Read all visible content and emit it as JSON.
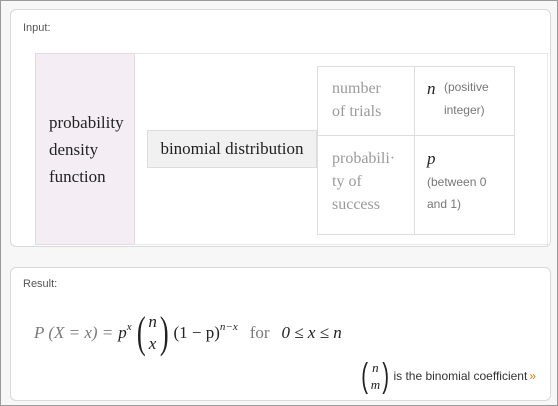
{
  "input": {
    "title": "Input:",
    "function_label_lines": [
      "probability",
      "density",
      "function"
    ],
    "distribution": "binomial distribution",
    "params": [
      {
        "name_lines": [
          "number",
          "of trials"
        ],
        "symbol": "n",
        "note": "(positive integer)"
      },
      {
        "name_lines": [
          "probabili·",
          "ty of",
          "success"
        ],
        "symbol": "p",
        "note": "(between 0 and 1)"
      }
    ]
  },
  "result": {
    "title": "Result:",
    "formula": {
      "lhs": "P (X = x) =",
      "base": "p",
      "exp1": "x",
      "binom_top": "n",
      "binom_bottom": "x",
      "factor": "(1 − p)",
      "exp2": "n−x",
      "for_text": "for",
      "condition": "0 ≤ x ≤ n"
    },
    "note": {
      "binom_top": "n",
      "binom_bottom": "m",
      "text": "is the binomial coefficient",
      "arrow": "»"
    }
  }
}
